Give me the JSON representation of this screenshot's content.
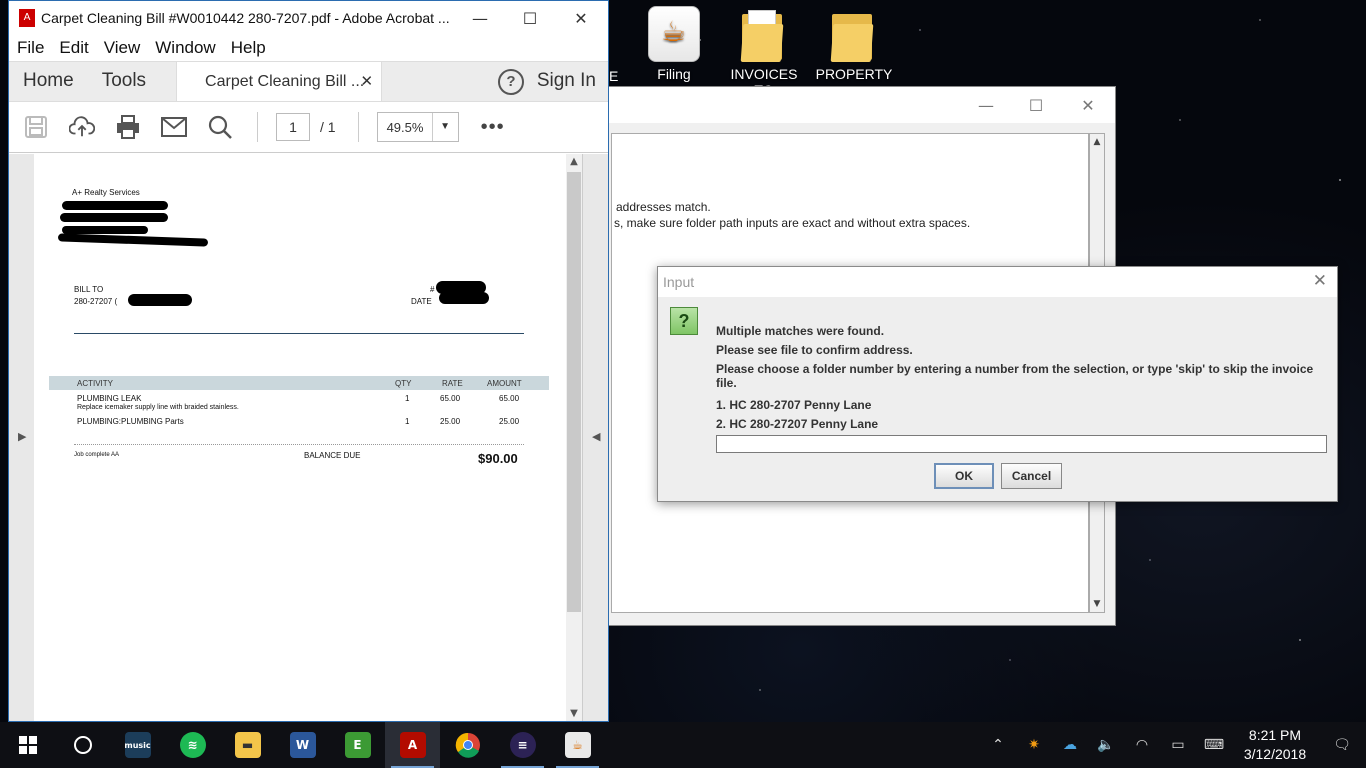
{
  "desktop": {
    "icons": [
      {
        "label": "Filing",
        "icon": "java-icon"
      },
      {
        "label": "INVOICES TO",
        "icon": "folder-icon"
      },
      {
        "label": "PROPERTY",
        "icon": "folder-icon"
      }
    ],
    "partial_label": "E"
  },
  "acrobat": {
    "title": "Carpet Cleaning Bill #W0010442 280-7207.pdf - Adobe Acrobat ...",
    "menu": [
      "File",
      "Edit",
      "View",
      "Window",
      "Help"
    ],
    "nav_tabs": [
      "Home",
      "Tools"
    ],
    "doc_tab": "Carpet Cleaning Bill ...",
    "help": "?",
    "sign_in": "Sign In",
    "page_current": "1",
    "page_total": "/ 1",
    "zoom": "49.5%",
    "more": "•••"
  },
  "invoice": {
    "company": "A+ Realty Services",
    "bill_to": "BILL TO",
    "bill_to_value": "280-27207 (",
    "number_label": "#",
    "date_label": "DATE",
    "columns": [
      "ACTIVITY",
      "QTY",
      "RATE",
      "AMOUNT"
    ],
    "rows": [
      {
        "activity": "PLUMBING LEAK",
        "desc": "Replace icemaker supply line with braided stainless.",
        "qty": "1",
        "rate": "65.00",
        "amount": "65.00"
      },
      {
        "activity": "PLUMBING:PLUMBING Parts",
        "desc": "",
        "qty": "1",
        "rate": "25.00",
        "amount": "25.00"
      }
    ],
    "note": "Job complete AA",
    "balance_label": "BALANCE DUE",
    "balance": "$90.00"
  },
  "bg_window": {
    "line1": "addresses match.",
    "line2": "s, make sure folder path inputs are exact and without extra spaces."
  },
  "dialog": {
    "title": "Input",
    "msg1": "Multiple matches were found.",
    "msg2": "Please see file to confirm address.",
    "msg3": "Please choose a folder number by entering a number from the selection, or type 'skip' to skip the invoice file.",
    "option1": "1. HC 280-2707 Penny Lane",
    "option2": "2. HC 280-27207 Penny Lane",
    "input_value": "",
    "ok": "OK",
    "cancel": "Cancel"
  },
  "taskbar": {
    "time": "8:21 PM",
    "date": "3/12/2018",
    "apps": [
      "start-icon",
      "cortana-icon",
      "amazon-music-icon",
      "spotify-icon",
      "file-explorer-icon",
      "word-icon",
      "evernote-icon",
      "acrobat-icon",
      "chrome-icon",
      "eclipse-icon",
      "java-icon"
    ]
  },
  "colors": {
    "accent": "#2b6cb0",
    "desktop_bg": "#05070d",
    "taskbar_bg": "#0e0f14",
    "invoice_header": "#cad7dc"
  }
}
